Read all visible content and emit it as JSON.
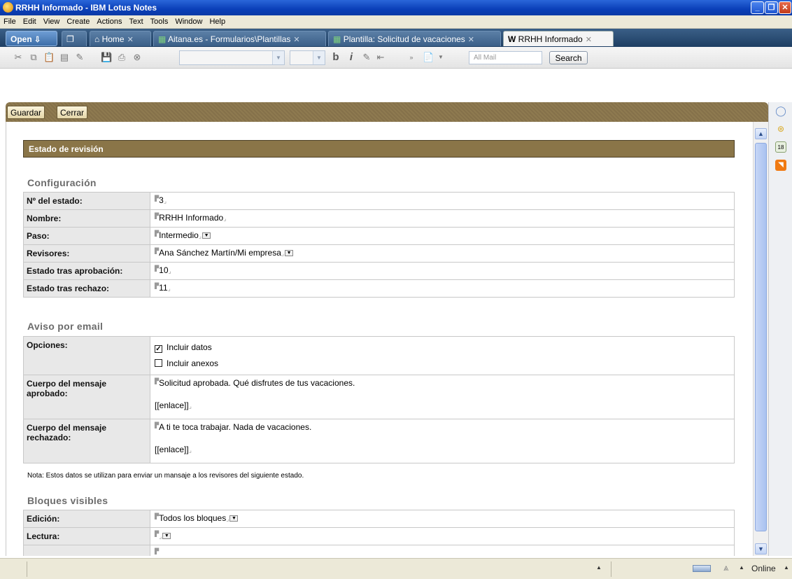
{
  "window": {
    "title": "RRHH Informado - IBM Lotus Notes"
  },
  "menu": [
    "File",
    "Edit",
    "View",
    "Create",
    "Actions",
    "Text",
    "Tools",
    "Window",
    "Help"
  ],
  "tabs": {
    "open_label": "Open",
    "items": [
      {
        "label": "Home"
      },
      {
        "label": "Aitana.es - Formularios\\Plantillas"
      },
      {
        "label": "Plantilla: Solicitud de vacaciones"
      },
      {
        "label": "RRHH Informado"
      }
    ]
  },
  "toolbar": {
    "search_placeholder": "All Mail",
    "search_label": "Search",
    "bold": "b",
    "italic": "i"
  },
  "actions": {
    "save": "Guardar",
    "close": "Cerrar"
  },
  "document": {
    "header": "Estado de revisión",
    "config": {
      "title": "Configuración",
      "rows": [
        {
          "label": "Nº del estado:",
          "value": "3"
        },
        {
          "label": "Nombre:",
          "value": "RRHH Informado"
        },
        {
          "label": "Paso:",
          "value": "Intermedio"
        },
        {
          "label": "Revisores:",
          "value": "Ana Sánchez Martín/Mi empresa"
        },
        {
          "label": "Estado tras aprobación:",
          "value": "10"
        },
        {
          "label": "Estado tras rechazo:",
          "value": "11"
        }
      ]
    },
    "email": {
      "title": "Aviso por email",
      "options_label": "Opciones:",
      "opt1": "Incluir datos",
      "opt1_checked": true,
      "opt2": "Incluir anexos",
      "opt2_checked": false,
      "approved_label": "Cuerpo del mensaje aprobado:",
      "approved_text": "Solicitud aprobada. Qué disfrutes de tus vacaciones.",
      "approved_link": "[[enlace]]",
      "rejected_label": "Cuerpo del mensaje rechazado:",
      "rejected_text": "A ti te toca trabajar. Nada de vacaciones.",
      "rejected_link": "[[enlace]]"
    },
    "note": "Nota: Estos datos se utilizan para enviar un mansaje a los revisores del siguiente estado.",
    "blocks": {
      "title": "Bloques visibles",
      "edit_label": "Edición:",
      "edit_value": "Todos los bloques",
      "read_label": "Lectura:",
      "read_value": ""
    }
  },
  "status": {
    "online": "Online"
  }
}
